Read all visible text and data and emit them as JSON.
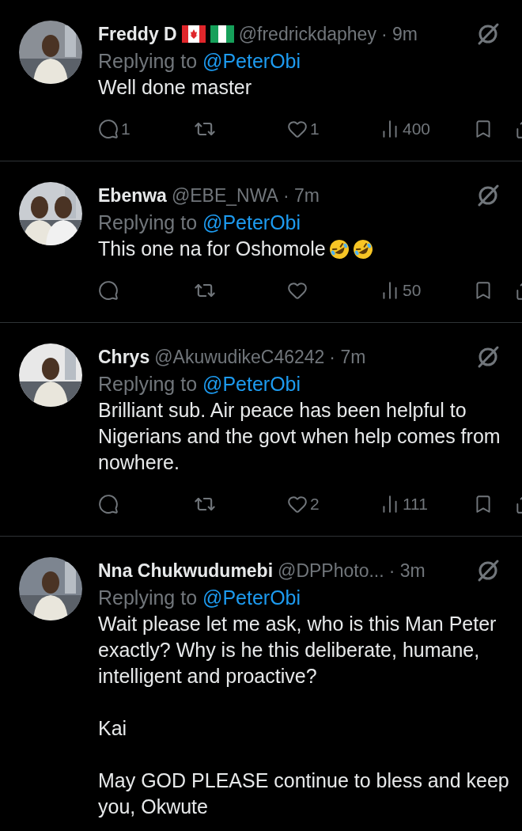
{
  "replies": [
    {
      "name": "Freddy D",
      "flags": [
        {
          "kind": "canada"
        },
        {
          "kind": "nigeria"
        }
      ],
      "handle": "@fredrickdaphey",
      "time": "· 9m",
      "replying_prefix": "Replying to",
      "replying_to": "@PeterObi",
      "paragraphs": [
        "Well done master"
      ],
      "avatar": {
        "kind": "picture"
      },
      "replies_count": "1",
      "likes": "1",
      "views": "400"
    },
    {
      "name": "Ebenwa",
      "handle": "@EBE_NWA",
      "time": "· 7m",
      "replying_prefix": "Replying to",
      "replying_to": "@PeterObi",
      "paragraphs": [
        "This one na for Oshomole"
      ],
      "emojis": [
        {
          "kind": "rolling-laugh"
        },
        {
          "kind": "rolling-laugh"
        }
      ],
      "avatar": {
        "kind": "picture"
      },
      "views": "50"
    },
    {
      "name": "Chrys",
      "handle": "@AkuwudikeC46242",
      "time": "· 7m",
      "replying_prefix": "Replying to",
      "replying_to": "@PeterObi",
      "paragraphs": [
        "Brilliant sub. Air peace has been helpful to\nNigerians and the govt when help comes from\nnowhere."
      ],
      "avatar": {
        "kind": "picture"
      },
      "likes": "2",
      "views": "111"
    },
    {
      "name": "Nna Chukwudumebi",
      "handle": "@DPPhoto...",
      "time": "· 3m",
      "replying_prefix": "Replying to",
      "replying_to": "@PeterObi",
      "paragraphs": [
        "Wait please let me ask, who is this Man Peter\nexactly? Why is he this deliberate, humane,\nintelligent and proactive?",
        "Kai",
        "May GOD PLEASE continue to bless and keep\nyou, Okwute"
      ],
      "avatar": {
        "kind": "picture"
      }
    }
  ]
}
